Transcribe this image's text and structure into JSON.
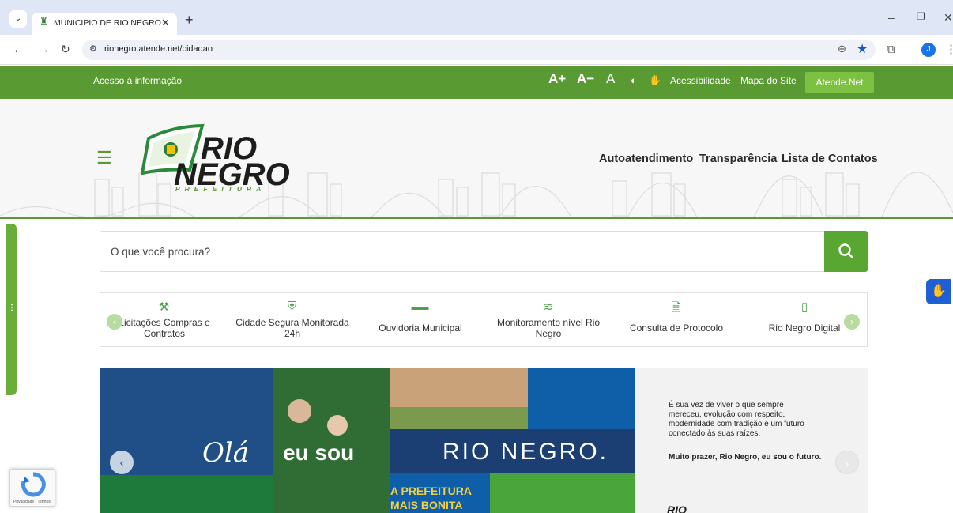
{
  "browser": {
    "tab_title": "MUNICIPIO DE RIO NEGRO",
    "url": "rionegro.atende.net/cidadao",
    "profile_initial": "J"
  },
  "topbar": {
    "acesso": "Acesso à informação",
    "font_increase": "A+",
    "font_decrease": "A−",
    "font_reset": "A",
    "acessibilidade": "Acessibilidade",
    "mapa": "Mapa do Site",
    "atende": "Atende.Net"
  },
  "logo": {
    "line1": "RIO",
    "line2": "NEGRO",
    "sub": "PREFEITURA"
  },
  "header_nav": [
    "Autoatendimento",
    "Transparência",
    "Lista de Contatos"
  ],
  "search": {
    "placeholder": "O que você procura?"
  },
  "quick_links": [
    {
      "label": "Licitações Compras e Contratos",
      "icon": "gavel-icon"
    },
    {
      "label": "Cidade Segura Monitorada 24h",
      "icon": "shield-icon"
    },
    {
      "label": "Ouvidoria Municipal",
      "icon": "ouvidoria-logo-icon"
    },
    {
      "label": "Monitoramento nível Rio Negro",
      "icon": "river-level-icon"
    },
    {
      "label": "Consulta de Protocolo",
      "icon": "document-search-icon"
    },
    {
      "label": "Rio Negro Digital",
      "icon": "digital-phone-icon"
    }
  ],
  "banner": {
    "ola": "Olá",
    "eu_sou": "eu sou",
    "rio_negro": "RIO NEGRO.",
    "prefeitura_line1": "A PREFEITURA",
    "prefeitura_line2": "MAIS BONITA",
    "text": "É sua vez de viver o que sempre mereceu, evolução com respeito, modernidade com tradição e um futuro conectado às suas raízes.",
    "bold": "Muito prazer, Rio Negro, eu sou o futuro.",
    "mini_logo": "RIO"
  },
  "recaptcha": {
    "terms": "Privacidade - Termos"
  },
  "colors": {
    "brand_green": "#5a9a33",
    "accent_green": "#7cc142",
    "banner_blue": "#1f4f86"
  }
}
